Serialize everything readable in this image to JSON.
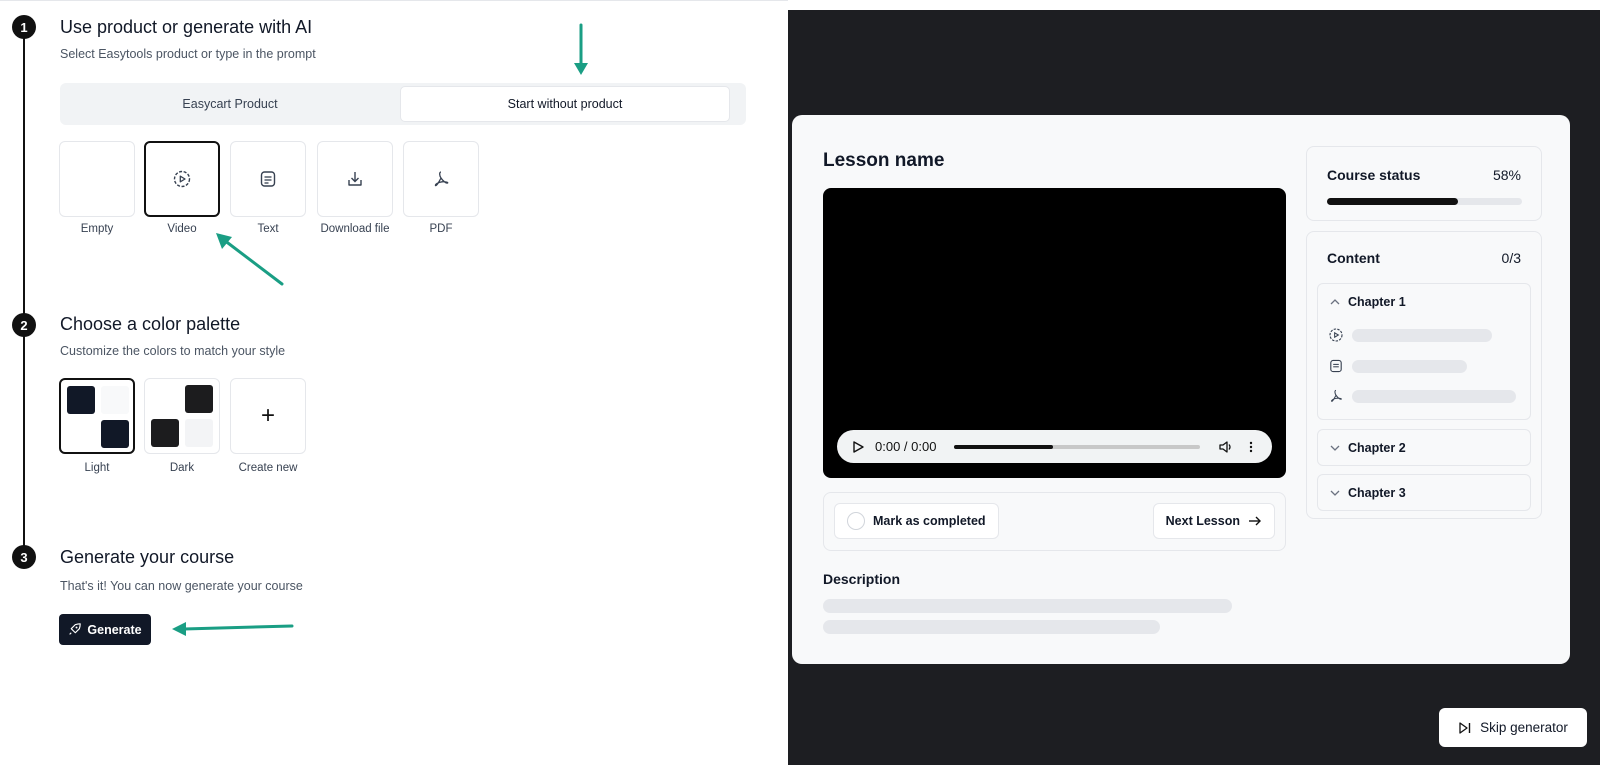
{
  "steps": [
    {
      "num": "1",
      "title": "Use product or generate with AI",
      "subtitle": "Select Easytools product or type in the prompt"
    },
    {
      "num": "2",
      "title": "Choose a color palette",
      "subtitle": "Customize the colors to match your style"
    },
    {
      "num": "3",
      "title": "Generate your course",
      "subtitle": "That's it! You can now generate your course"
    }
  ],
  "source_tabs": [
    "Easycart Product",
    "Start without product"
  ],
  "lesson_types": [
    {
      "label": "Empty",
      "icon": "none"
    },
    {
      "label": "Video",
      "icon": "video-icon",
      "selected": true
    },
    {
      "label": "Text",
      "icon": "text-icon"
    },
    {
      "label": "Download file",
      "icon": "download-icon"
    },
    {
      "label": "PDF",
      "icon": "pdf-icon"
    }
  ],
  "palettes": [
    {
      "label": "Light",
      "selected": true
    },
    {
      "label": "Dark"
    },
    {
      "label": "Create new"
    }
  ],
  "generate_label": "Generate",
  "preview": {
    "lesson_title": "Lesson name",
    "video_time": "0:00 / 0:00",
    "video_progress": 0.4,
    "mark_completed": "Mark as completed",
    "next_lesson": "Next Lesson",
    "description_label": "Description",
    "course_status_label": "Course status",
    "course_status_value": "58%",
    "course_progress": 0.67,
    "content_label": "Content",
    "content_value": "0/3",
    "chapters": [
      "Chapter 1",
      "Chapter 2",
      "Chapter 3"
    ]
  },
  "skip_label": "Skip generator",
  "colors": {
    "accent_arrow": "#1a9e84",
    "dark": "#111827",
    "panel_bg": "#1d1e22"
  }
}
